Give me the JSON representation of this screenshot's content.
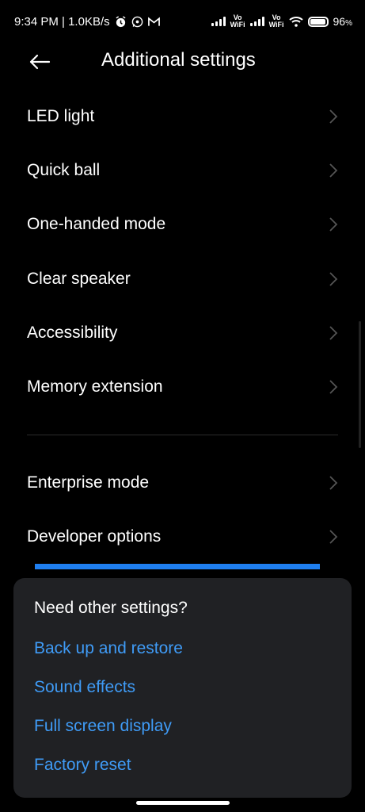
{
  "status_bar": {
    "time_speed": "9:34 PM | 1.0KB/s",
    "vowifi_1": "Vo\nWiFi",
    "vowifi_2": "Vo\nWiFi",
    "battery_percent": "96",
    "battery_unit": "%",
    "battery_level": 0.96
  },
  "header": {
    "title": "Additional settings"
  },
  "settings": [
    {
      "label": "LED light"
    },
    {
      "label": "Quick ball"
    },
    {
      "label": "One-handed mode"
    },
    {
      "label": "Clear speaker"
    },
    {
      "label": "Accessibility"
    },
    {
      "label": "Memory extension"
    },
    {
      "label": "Enterprise mode"
    },
    {
      "label": "Developer options"
    }
  ],
  "other_settings": {
    "title": "Need other settings?",
    "links": [
      {
        "label": "Back up and restore"
      },
      {
        "label": "Sound effects"
      },
      {
        "label": "Full screen display"
      },
      {
        "label": "Factory reset"
      }
    ]
  },
  "colors": {
    "background": "#000000",
    "card": "#202124",
    "link": "#3f9bf6",
    "accent_bar": "#1f7ff0"
  }
}
